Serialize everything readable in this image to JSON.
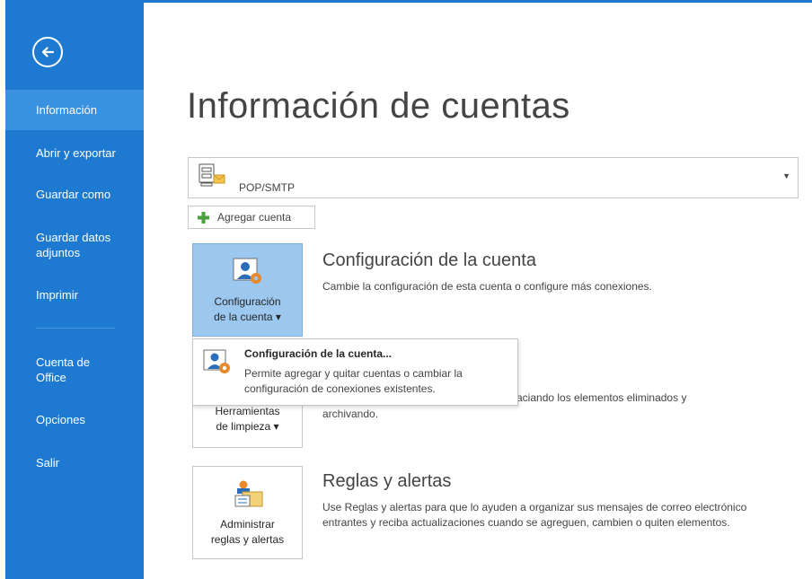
{
  "sidebar": {
    "items": [
      {
        "label": "Información",
        "active": true
      },
      {
        "label": "Abrir y exportar"
      },
      {
        "label": "Guardar como"
      },
      {
        "label": "Guardar datos adjuntos"
      },
      {
        "label": "Imprimir"
      },
      {
        "label": "Cuenta de Office"
      },
      {
        "label": "Opciones"
      },
      {
        "label": "Salir"
      }
    ],
    "back_icon": "back-arrow-icon"
  },
  "main": {
    "title": "Información de cuentas",
    "account": {
      "type": "POP/SMTP"
    },
    "add_account_label": "Agregar cuenta",
    "sections": {
      "account_settings": {
        "tile_label_line1": "Configuración",
        "tile_label_line2": "de la cuenta ▾",
        "title": "Configuración de la cuenta",
        "desc": "Cambie la configuración de esta cuenta o configure más conexiones."
      },
      "cleanup": {
        "tile_label_line1": "Herramientas",
        "tile_label_line2": "de limpieza ▾",
        "desc_line1_visible": "aciando los elementos eliminados y",
        "desc_line2": "archivando."
      },
      "rules": {
        "tile_label_line1": "Administrar",
        "tile_label_line2": "reglas y alertas",
        "title": "Reglas y alertas",
        "desc": "Use Reglas y alertas para que lo ayuden a organizar sus mensajes de correo electrónico entrantes y reciba actualizaciones cuando se agreguen, cambien o quiten elementos."
      }
    },
    "popup": {
      "title": "Configuración de la cuenta...",
      "desc": "Permite agregar y quitar cuentas o cambiar la configuración de conexiones existentes."
    }
  },
  "colors": {
    "sidebar": "#1e7ad0",
    "sidebar_active": "#3a91e0",
    "tile_selected": "#9cc7ef"
  }
}
